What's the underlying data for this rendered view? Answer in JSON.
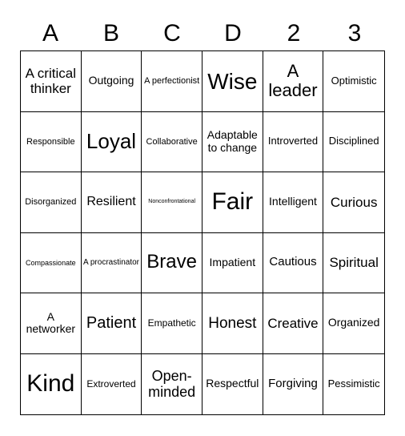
{
  "header": [
    "A",
    "B",
    "C",
    "D",
    "2",
    "3"
  ],
  "cells": [
    [
      "A critical thinker",
      "Outgoing",
      "A perfectionist",
      "Wise",
      "A leader",
      "Optimistic"
    ],
    [
      "Responsible",
      "Loyal",
      "Collaborative",
      "Adaptable to change",
      "Introverted",
      "Disciplined"
    ],
    [
      "Disorganized",
      "Resilient",
      "Nonconfrontational",
      "Fair",
      "Intelligent",
      "Curious"
    ],
    [
      "Compassionate",
      "A procrastinator",
      "Brave",
      "Impatient",
      "Cautious",
      "Spiritual"
    ],
    [
      "A networker",
      "Patient",
      "Empathetic",
      "Honest",
      "Creative",
      "Organized"
    ],
    [
      "Kind",
      "Extroverted",
      "Open-minded",
      "Respectful",
      "Forgiving",
      "Pessimistic"
    ]
  ]
}
